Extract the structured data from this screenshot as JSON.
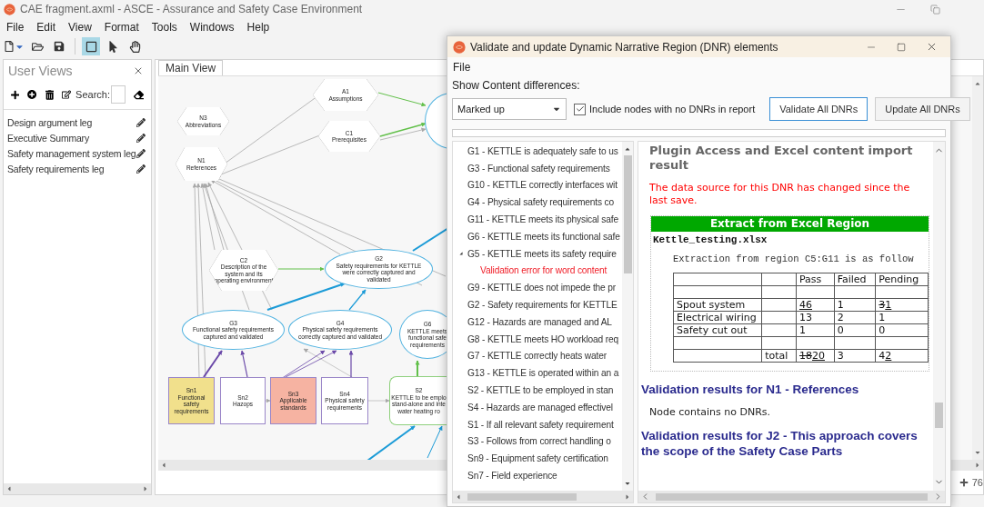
{
  "window": {
    "title": "CAE fragment.axml - ASCE - Assurance and Safety Case Environment"
  },
  "menu": [
    "File",
    "Edit",
    "View",
    "Format",
    "Tools",
    "Windows",
    "Help"
  ],
  "tools": [
    {
      "kind": "rectangle",
      "selected": true
    },
    {
      "kind": "pointer",
      "selected": false
    },
    {
      "kind": "hand",
      "selected": false
    }
  ],
  "user_views": {
    "title": "User Views",
    "search_label": "Search:",
    "items": [
      "Design argument leg",
      "Executive Summary",
      "Safety management system leg",
      "Safety requirements leg"
    ]
  },
  "main_view": {
    "tab": "Main View",
    "zoom": "76",
    "nodes": [
      {
        "kind": "hexagon",
        "id": "A1",
        "label": [
          "Assumptions"
        ]
      },
      {
        "kind": "ellipse"
      },
      {
        "kind": "hexagon",
        "id": "N3",
        "label": [
          "Abbreviations"
        ]
      },
      {
        "kind": "hexagon",
        "id": "C1",
        "label": [
          "Prerequisites"
        ]
      },
      {
        "kind": "hexagon",
        "id": "N1",
        "label": [
          "References"
        ]
      },
      {
        "kind": "hexagon",
        "id": "C2",
        "label": [
          "Description of the",
          "system and its",
          "operating environment"
        ]
      },
      {
        "kind": "ellipse",
        "id": "G2",
        "label": [
          "Safety requirements for KETTLE",
          "were correctly captured and",
          "validated"
        ]
      },
      {
        "kind": "ellipse",
        "id": "G3",
        "label": [
          "Functional safety requirements",
          "captured and validated"
        ]
      },
      {
        "kind": "ellipse",
        "id": "G4",
        "label": [
          "Physical safety requirements",
          "correctly captured and validated"
        ]
      },
      {
        "kind": "ellipse",
        "id": "G6",
        "label": [
          "KETTLE meets",
          "functional safe",
          "requirements"
        ]
      },
      {
        "kind": "rect",
        "id": "Sn1",
        "label": [
          "Functional",
          "safety",
          "requirements"
        ],
        "color": "#f1e08c"
      },
      {
        "kind": "rect",
        "id": "Sn2",
        "label": [
          "Hazops"
        ],
        "color": "#ffffff"
      },
      {
        "kind": "rect",
        "id": "Sn3",
        "label": [
          "Applicable",
          "standards"
        ],
        "color": "#f6b3a2"
      },
      {
        "kind": "rect",
        "id": "Sn4",
        "label": [
          "Physical safety",
          "requirements"
        ],
        "color": "#ffffff"
      },
      {
        "kind": "rounded",
        "id": "S2",
        "label": [
          "KETTLE to be emplo",
          "stand-alone and inte",
          "water heating ro"
        ]
      }
    ]
  },
  "dialog": {
    "title": "Validate and update Dynamic Narrative Region (DNR) elements",
    "menu": [
      "File"
    ],
    "diff_label": "Show Content differences:",
    "diff_mode": "Marked up",
    "include_checkbox": {
      "label": "Include nodes with no DNRs in report",
      "checked": true
    },
    "buttons": [
      {
        "label": "Validate All DNRs",
        "focused": true
      },
      {
        "label": "Update All DNRs",
        "focused": false
      }
    ],
    "progress": {
      "level": 0
    },
    "tree": [
      {
        "label": "G1 - KETTLE is adequately safe to us"
      },
      {
        "label": "G3 - Functional safety requirements"
      },
      {
        "label": "G10 - KETTLE correctly interfaces wit"
      },
      {
        "label": "G4 - Physical safety requirements co"
      },
      {
        "label": "G11 - KETTLE meets its physical safe"
      },
      {
        "label": "G6 - KETTLE meets its functional safe"
      },
      {
        "label": "G5 - KETTLE meets its safety require",
        "expanded": true,
        "children": [
          {
            "label": "Validation error for word content",
            "kind": "error"
          }
        ]
      },
      {
        "label": "G9 - KETTLE does not impede the pr"
      },
      {
        "label": "G2 - Safety requirements for KETTLE"
      },
      {
        "label": "G12 - Hazards are managed and AL"
      },
      {
        "label": "G8 - KETTLE meets HO workload req"
      },
      {
        "label": "G7 - KETTLE correctly heats water"
      },
      {
        "label": "G13 - KETTLE is operated within an a"
      },
      {
        "label": "S2 - KETTLE to be employed in stan"
      },
      {
        "label": "S4 - Hazards are managed effectivel"
      },
      {
        "label": "S1 - If all relevant safety requirement"
      },
      {
        "label": "S3 - Follows from correct handling o"
      },
      {
        "label": "Sn9 - Equipment safety certification"
      },
      {
        "label": "Sn7 - Field experience"
      }
    ],
    "report": {
      "heading": "Plugin Access and Excel content import result",
      "warning": "The data source for this DNR has changed since the last save.",
      "extract": {
        "title": "Extract from Excel Region",
        "file": "Kettle_testing.xlsx",
        "caption": "Extraction from region C5:G11 is as follow",
        "columns": [
          "Pass",
          "Failed",
          "Pending"
        ],
        "rows": [
          {
            "kind": "blank"
          },
          {
            "kind": "data",
            "label": "Spout system",
            "values": [
              [
                {
                  "text": "46",
                  "deleted": false,
                  "inserted": true
                }
              ],
              "1",
              [
                {
                  "text": "3",
                  "deleted": true,
                  "inserted": false
                },
                {
                  "text": "1",
                  "deleted": false,
                  "inserted": true
                }
              ]
            ]
          },
          {
            "kind": "data",
            "label": "Electrical wiring",
            "values": [
              "13",
              "2",
              "1"
            ]
          },
          {
            "kind": "data",
            "label": "Safety cut out",
            "values": [
              "1",
              "0",
              "0"
            ]
          },
          {
            "kind": "blank"
          },
          {
            "kind": "total",
            "label": "total",
            "values": [
              [
                {
                  "text": "18",
                  "deleted": true,
                  "inserted": false
                },
                {
                  "text": "20",
                  "deleted": false,
                  "inserted": true
                }
              ],
              "3",
              [
                {
                  "text": "4",
                  "deleted": false,
                  "inserted": false
                },
                {
                  "text": "2",
                  "deleted": false,
                  "inserted": true
                }
              ]
            ]
          }
        ]
      },
      "sections": [
        {
          "heading": "Validation results for N1 - References",
          "note": "Node contains no DNRs."
        },
        {
          "heading": "Validation results for J2 - This approach covers the scope of the Safety Case Parts"
        }
      ]
    }
  }
}
